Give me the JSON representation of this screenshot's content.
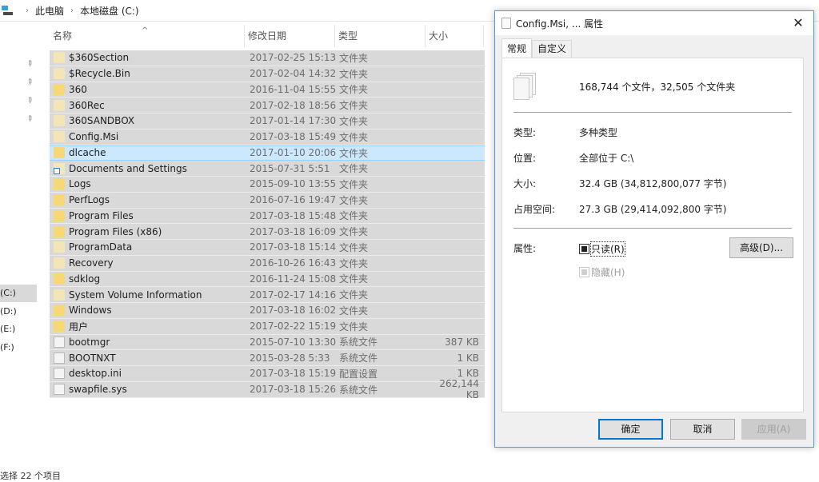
{
  "explorer": {
    "breadcrumb": [
      "此电脑",
      "本地磁盘 (C:)"
    ],
    "nav_drives": [
      {
        "label": "(C:)",
        "selected": true
      },
      {
        "label": "(D:)",
        "selected": false
      },
      {
        "label": "(E:)",
        "selected": false
      },
      {
        "label": "(F:)",
        "selected": false
      }
    ],
    "columns": {
      "name": "名称",
      "date": "修改日期",
      "type": "类型",
      "size": "大小"
    },
    "files": [
      {
        "name": "$360Section",
        "date": "2017-02-25 15:13",
        "type": "文件夹",
        "size": "",
        "icon": "folder-dim"
      },
      {
        "name": "$Recycle.Bin",
        "date": "2017-02-04 14:32",
        "type": "文件夹",
        "size": "",
        "icon": "folder-dim"
      },
      {
        "name": "360",
        "date": "2016-11-04 15:55",
        "type": "文件夹",
        "size": "",
        "icon": "folder"
      },
      {
        "name": "360Rec",
        "date": "2017-02-18 18:56",
        "type": "文件夹",
        "size": "",
        "icon": "folder-dim"
      },
      {
        "name": "360SANDBOX",
        "date": "2017-01-14 17:30",
        "type": "文件夹",
        "size": "",
        "icon": "folder-dim"
      },
      {
        "name": "Config.Msi",
        "date": "2017-03-18 15:49",
        "type": "文件夹",
        "size": "",
        "icon": "folder-dim"
      },
      {
        "name": "dlcache",
        "date": "2017-01-10 20:06",
        "type": "文件夹",
        "size": "",
        "icon": "folder",
        "focused": true
      },
      {
        "name": "Documents and Settings",
        "date": "2015-07-31 5:51",
        "type": "文件夹",
        "size": "",
        "icon": "shortcut"
      },
      {
        "name": "Logs",
        "date": "2015-09-10 13:55",
        "type": "文件夹",
        "size": "",
        "icon": "folder"
      },
      {
        "name": "PerfLogs",
        "date": "2016-07-16 19:47",
        "type": "文件夹",
        "size": "",
        "icon": "folder"
      },
      {
        "name": "Program Files",
        "date": "2017-03-18 15:48",
        "type": "文件夹",
        "size": "",
        "icon": "folder"
      },
      {
        "name": "Program Files (x86)",
        "date": "2017-03-18 16:09",
        "type": "文件夹",
        "size": "",
        "icon": "folder"
      },
      {
        "name": "ProgramData",
        "date": "2017-03-18 15:14",
        "type": "文件夹",
        "size": "",
        "icon": "folder-dim"
      },
      {
        "name": "Recovery",
        "date": "2016-10-26 16:43",
        "type": "文件夹",
        "size": "",
        "icon": "folder-dim"
      },
      {
        "name": "sdklog",
        "date": "2016-11-24 15:08",
        "type": "文件夹",
        "size": "",
        "icon": "folder"
      },
      {
        "name": "System Volume Information",
        "date": "2017-02-17 14:16",
        "type": "文件夹",
        "size": "",
        "icon": "folder-dim"
      },
      {
        "name": "Windows",
        "date": "2017-03-18 16:02",
        "type": "文件夹",
        "size": "",
        "icon": "folder"
      },
      {
        "name": "用户",
        "date": "2017-02-22 15:19",
        "type": "文件夹",
        "size": "",
        "icon": "folder"
      },
      {
        "name": "bootmgr",
        "date": "2015-07-10 13:30",
        "type": "系统文件",
        "size": "387 KB",
        "icon": "file"
      },
      {
        "name": "BOOTNXT",
        "date": "2015-03-28 5:33",
        "type": "系统文件",
        "size": "1 KB",
        "icon": "file"
      },
      {
        "name": "desktop.ini",
        "date": "2017-03-18 15:19",
        "type": "配置设置",
        "size": "1 KB",
        "icon": "file"
      },
      {
        "name": "swapfile.sys",
        "date": "2017-03-18 15:26",
        "type": "系统文件",
        "size": "262,144 KB",
        "icon": "file"
      }
    ],
    "status": "选择 22 个项目"
  },
  "dialog": {
    "title": "Config.Msi, ... 属性",
    "close_label": "✕",
    "tabs": [
      {
        "label": "常规",
        "active": true
      },
      {
        "label": "自定义",
        "active": false
      }
    ],
    "summary": "168,744 个文件，32,505 个文件夹",
    "properties": [
      {
        "label": "类型:",
        "value": "多种类型"
      },
      {
        "label": "位置:",
        "value": "全部位于 C:\\"
      },
      {
        "label": "大小:",
        "value": "32.4 GB (34,812,800,077 字节)"
      },
      {
        "label": "占用空间:",
        "value": "27.3 GB (29,414,092,800 字节)"
      }
    ],
    "attributes_label": "属性:",
    "readonly": {
      "label": "只读(R)",
      "state": "indeterminate"
    },
    "hidden": {
      "label": "隐藏(H)",
      "state": "indeterminate",
      "disabled": true
    },
    "advanced_button": "高级(D)...",
    "buttons": {
      "ok": "确定",
      "cancel": "取消",
      "apply": "应用(A)"
    }
  }
}
